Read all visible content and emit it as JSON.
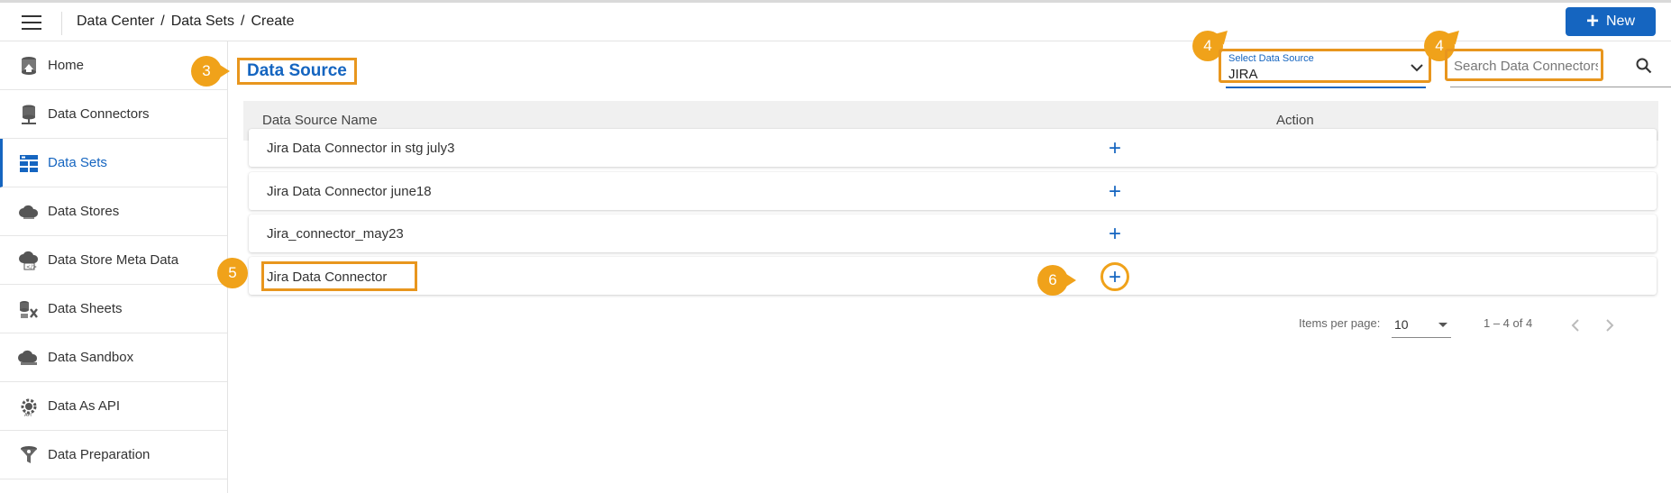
{
  "header": {
    "breadcrumb": [
      "Data Center",
      "Data Sets",
      "Create"
    ],
    "separator": "/",
    "new_button": {
      "icon": "plus-icon",
      "label": "New"
    }
  },
  "sidebar": {
    "items": [
      {
        "label": "Home",
        "icon": "home-icon"
      },
      {
        "label": "Data Connectors",
        "icon": "database-connectors-icon"
      },
      {
        "label": "Data Sets",
        "icon": "data-sets-icon",
        "active": true
      },
      {
        "label": "Data Stores",
        "icon": "cloud-icon"
      },
      {
        "label": "Data Store Meta Data",
        "icon": "cloud-meta-icon"
      },
      {
        "label": "Data Sheets",
        "icon": "data-sheets-icon"
      },
      {
        "label": "Data Sandbox",
        "icon": "cloud-sandbox-icon"
      },
      {
        "label": "Data As API",
        "icon": "api-gear-icon"
      },
      {
        "label": "Data Preparation",
        "icon": "data-preparation-icon"
      }
    ]
  },
  "main": {
    "title": "Data Source",
    "select": {
      "label": "Select Data Source",
      "value": "JIRA"
    },
    "search": {
      "placeholder": "Search Data Connectors"
    },
    "table": {
      "columns": [
        "Data Source Name",
        "Action"
      ],
      "rows": [
        {
          "name": "Jira Data Connector in stg july3",
          "action": "+"
        },
        {
          "name": "Jira Data Connector june18",
          "action": "+"
        },
        {
          "name": "Jira_connector_may23",
          "action": "+"
        },
        {
          "name": "Jira Data Connector",
          "action": "+"
        }
      ]
    },
    "pagination": {
      "items_per_page_label": "Items per page:",
      "items_per_page": "10",
      "range": "1 – 4 of 4"
    }
  },
  "annotations": {
    "badges": [
      "3",
      "4",
      "4",
      "5",
      "6"
    ]
  },
  "colors": {
    "accent": "#1565c0",
    "highlight": "#e8961e",
    "badge": "#f0a21a"
  }
}
